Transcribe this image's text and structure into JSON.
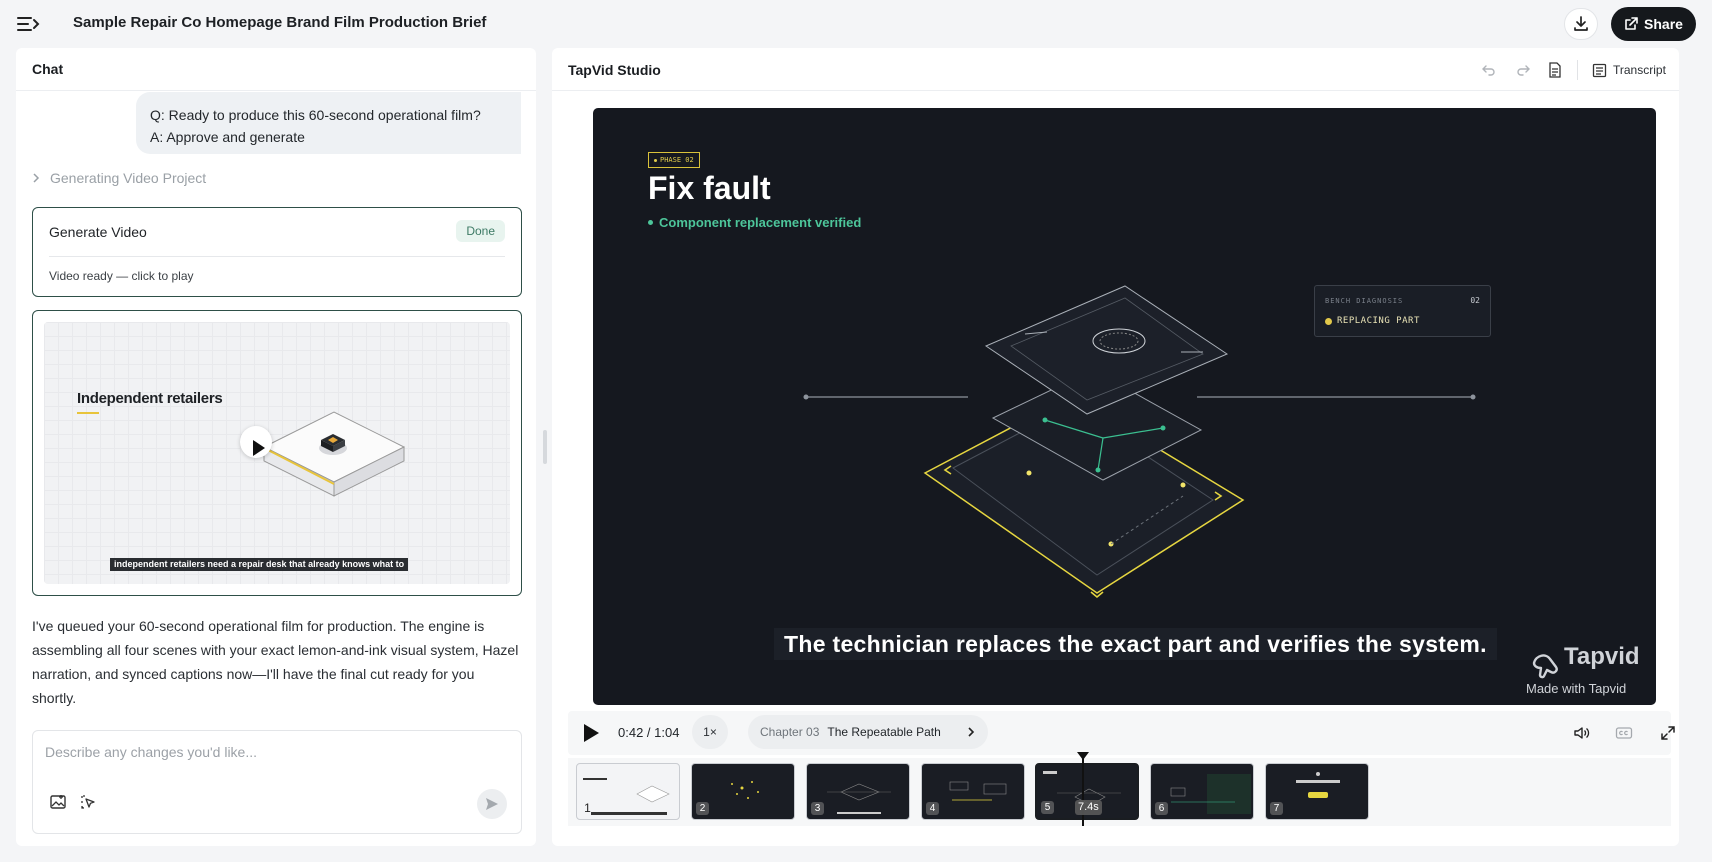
{
  "header": {
    "title": "Sample Repair Co Homepage Brand Film Production Brief",
    "share_label": "Share"
  },
  "chat": {
    "heading": "Chat",
    "question": "Q: Ready to produce this 60-second operational film?",
    "answer": "A: Approve and generate",
    "generating_label": "Generating Video Project",
    "task": {
      "title": "Generate Video",
      "status": "Done",
      "result": "Video ready — click to play"
    },
    "preview": {
      "title": "Independent retailers",
      "caption": "independent retailers need a repair desk that already knows what to"
    },
    "message": "I've queued your 60-second operational film for production. The engine is assembling all four scenes with your exact lemon-and-ink visual system, Hazel narration, and synced captions now—I'll have the final cut ready for you shortly.",
    "composer_placeholder": "Describe any changes you'd like..."
  },
  "studio": {
    "title": "TapVid Studio",
    "transcript_label": "Transcript",
    "video": {
      "phase_tag": "PHASE 02",
      "heading": "Fix fault",
      "status": "Component replacement verified",
      "diag_label": "BENCH DIAGNOSIS",
      "diag_number": "02",
      "diag_state": "REPLACING PART",
      "caption": "The technician replaces the exact part and verifies the system.",
      "brand_name": "Tapvid",
      "brand_sub": "Made with Tapvid"
    },
    "controls": {
      "time": "0:42 / 1:04",
      "speed": "1×",
      "chapter_label": "Chapter 03",
      "chapter_name": "The Repeatable Path"
    },
    "timeline": {
      "scenes": [
        "1",
        "2",
        "3",
        "4",
        "5",
        "6",
        "7"
      ],
      "active_scene": "5",
      "playhead_label": "7.4s"
    }
  },
  "colors": {
    "accent_yellow": "#e2cd4c",
    "status_green": "#4dc59a",
    "video_bg": "#15181f",
    "share_bg": "#15181c"
  }
}
